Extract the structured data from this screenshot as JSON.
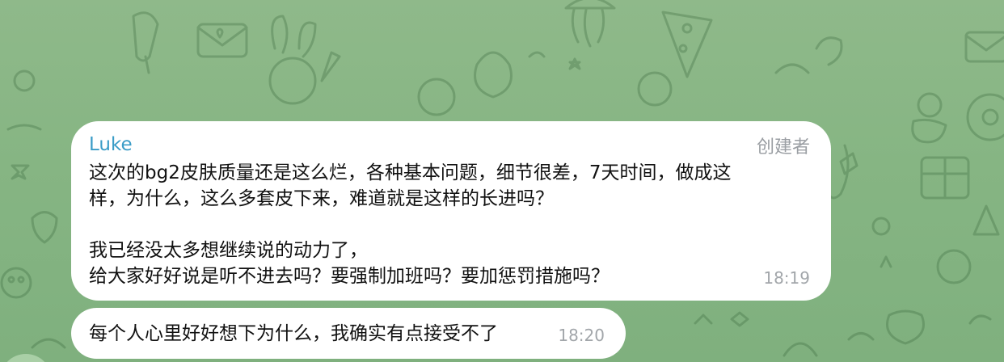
{
  "chat": {
    "messages": [
      {
        "sender": "Luke",
        "role": "创建者",
        "lines": [
          "这次的bg2皮肤质量还是这么烂，各种基本问题，细节很差，7天时间，做成这",
          "样，为什么，这么多套皮下来，难道就是这样的长进吗？",
          "",
          "我已经没太多想继续说的动力了，",
          "给大家好好说是听不进去吗？要强制加班吗？要加惩罚措施吗？"
        ],
        "time": "18:19"
      },
      {
        "text": "每个人心里好好想下为什么，我确实有点接受不了",
        "time": "18:20"
      }
    ]
  },
  "theme": {
    "background": "#86b583",
    "bubble": "#ffffff",
    "sender_color": "#3a9cc7",
    "meta_color": "#9a9ea3"
  },
  "icons": [
    "doodle-background-pattern",
    "avatar"
  ]
}
